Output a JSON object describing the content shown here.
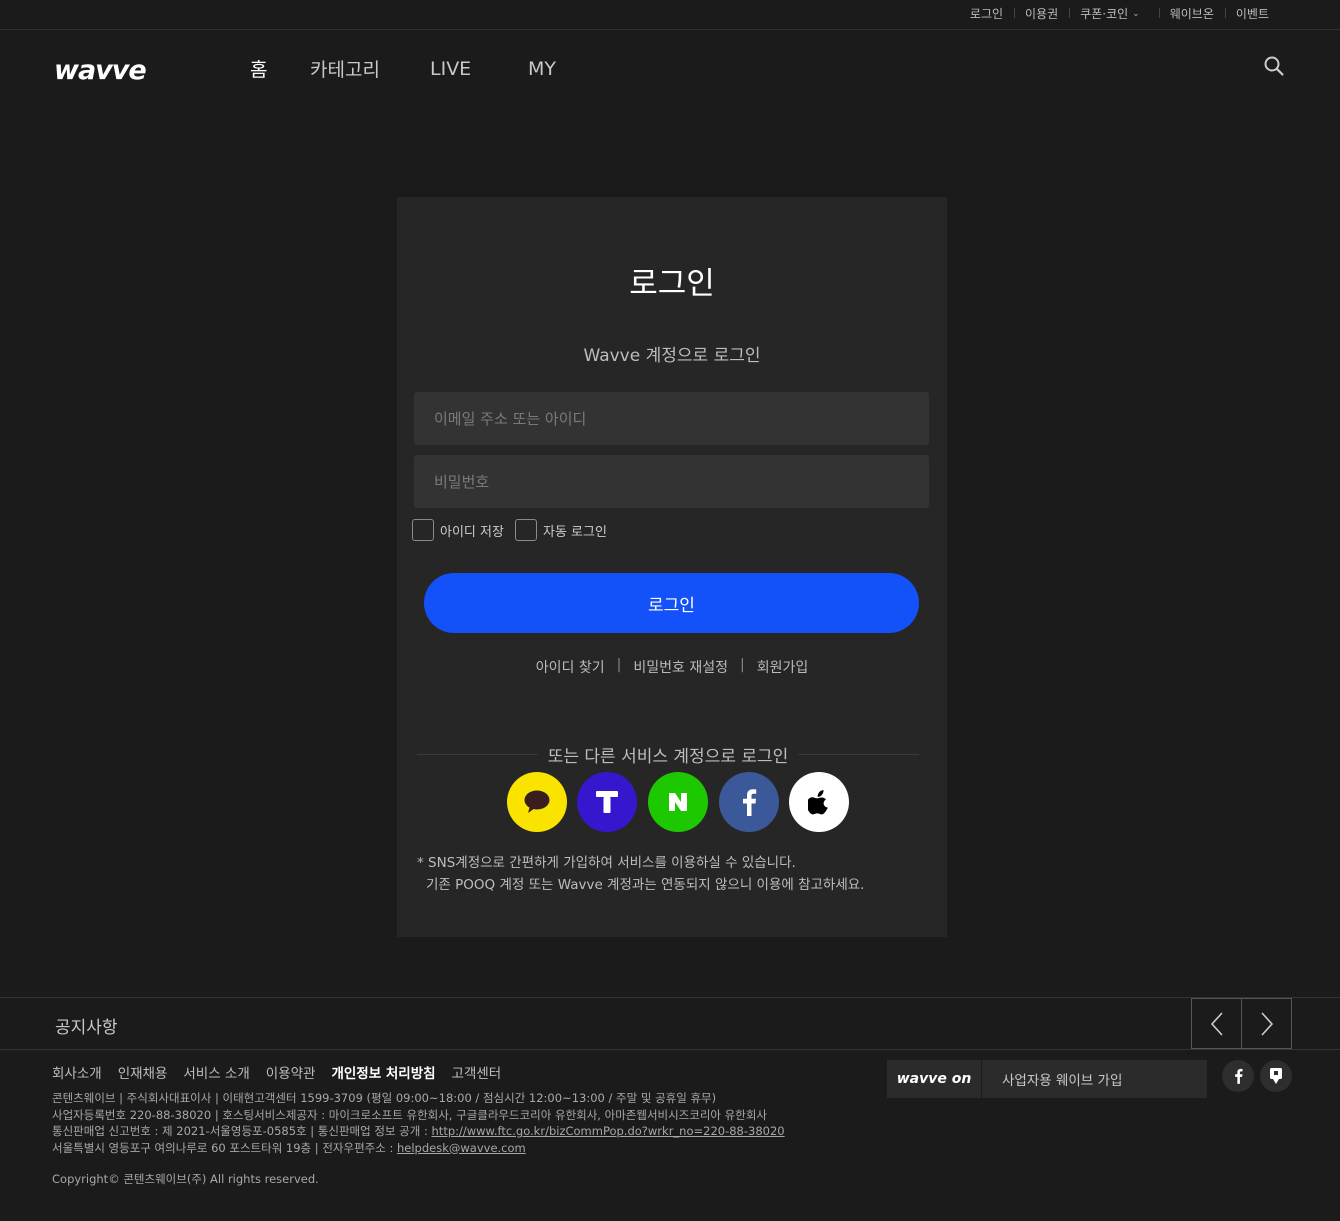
{
  "util_nav": [
    "로그인",
    "이용권",
    "쿠폰·코인",
    "웨이브온",
    "이벤트"
  ],
  "brand": "wavve",
  "main_nav": {
    "home": "홈",
    "category": "카테고리",
    "live": "LIVE",
    "my": "MY"
  },
  "login": {
    "title": "로그인",
    "subtitle": "Wavve 계정으로 로그인",
    "id_placeholder": "이메일 주소 또는 아이디",
    "pw_placeholder": "비밀번호",
    "save_id": "아이디 저장",
    "auto_login": "자동 로그인",
    "submit": "로그인",
    "find_id": "아이디 찾기",
    "reset_pw": "비밀번호 재설정",
    "signup": "회원가입",
    "sns_title": "또는 다른 서비스 계정으로 로그인",
    "sns": [
      "kakao-icon",
      "tworld-icon",
      "naver-icon",
      "facebook-icon",
      "apple-icon"
    ],
    "note_line1": "*  SNS계정으로 간편하게 가입하여 서비스를 이용하실 수 있습니다.",
    "note_line2": "기존 POOQ 계정 또는 Wavve 계정과는 연동되지 않으니 이용에 참고하세요."
  },
  "notice": {
    "label": "공지사항"
  },
  "footer": {
    "links": [
      "회사소개",
      "인재채용",
      "서비스 소개",
      "이용약관",
      "개인정보 처리방침",
      "고객센터"
    ],
    "info1": "콘텐츠웨이브 | 주식회사대표이사 | 이태현고객센터 1599-3709 (평일 09:00~18:00 / 점심시간 12:00~13:00 / 주말 및 공휴일 휴무)",
    "info2": "사업자등록번호 220-88-38020 | 호스팅서비스제공자 : 마이크로소프트 유한회사, 구글클라우드코리아 유한회사, 아마존웹서비시즈코리아 유한회사",
    "info3_prefix": "통신판매업 신고번호 : 제 2021-서울영등포-0585호 | 통신판매업 정보 공개 : ",
    "info3_link": "http://www.ftc.go.kr/bizCommPop.do?wrkr_no=220-88-38020",
    "info4_prefix": "서울특별시 영등포구 여의나루로 60 포스트타워 19층 | 전자우편주소 : ",
    "info4_link": "helpdesk@wavve.com",
    "copyright": "Copyright© 콘텐츠웨이브(주) All rights reserved.",
    "wavveon_logo": "wavve on",
    "wavveon_text": "사업자용 웨이브 가입"
  },
  "colors": {
    "accent": "#1351f9",
    "background": "#1b1b1b",
    "card": "#262626"
  }
}
